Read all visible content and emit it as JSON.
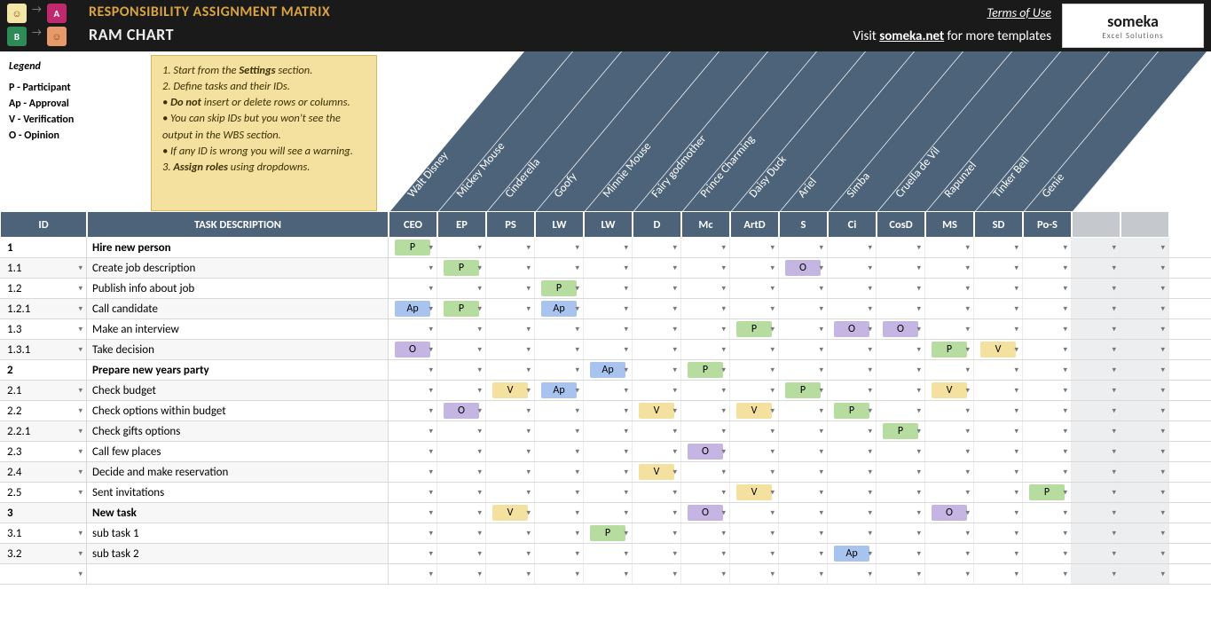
{
  "header": {
    "title1": "RESPONSIBILITY ASSIGNMENT MATRIX",
    "title2": "RAM CHART",
    "terms": "Terms of Use",
    "visit_pre": "Visit ",
    "visit_link": "someka.net",
    "visit_post": " for more templates",
    "logo": "someka",
    "logo_sub": "Excel Solutions",
    "nav_a": "A",
    "nav_b": "B"
  },
  "legend": {
    "title": "Legend",
    "items": [
      "P - Participant",
      "Ap - Approval",
      "V - Verification",
      "O - Opinion"
    ]
  },
  "instructions": [
    "1. Start from the <b>Settings</b> section.",
    "2. Define tasks and their IDs.",
    "• <b>Do not</b> insert or delete rows or columns.",
    "• You can skip IDs but you won't see the output in the WBS section.",
    "• If any ID is wrong you will see a warning.",
    "3. <b>Assign roles</b> using dropdowns."
  ],
  "people": [
    "Walt Disney",
    "Mickey Mouse",
    "Cinderella",
    "Goofy",
    "Minnie Mouse",
    "Fairy godmother",
    "Prince Charming",
    "Daisy Duck",
    "Ariel",
    "Simba",
    "Cruella de Vil",
    "Rapunzel",
    "Tinker Bell",
    "Genie"
  ],
  "col_id": "ID",
  "col_task": "TASK DESCRIPTION",
  "roles": [
    "CEO",
    "EP",
    "PS",
    "LW",
    "LW",
    "D",
    "Mc",
    "ArtD",
    "S",
    "Ci",
    "CosD",
    "MS",
    "SD",
    "Po-S"
  ],
  "extra_cols": 2,
  "rows": [
    {
      "id": "1",
      "task": "Hire new person",
      "bold": true,
      "cells": {
        "0": "P"
      }
    },
    {
      "id": "1.1",
      "task": "Create job description",
      "cells": {
        "1": "P",
        "8": "O"
      }
    },
    {
      "id": "1.2",
      "task": "Publish info about job",
      "cells": {
        "3": "P"
      }
    },
    {
      "id": "1.2.1",
      "task": "Call candidate",
      "cells": {
        "0": "Ap",
        "1": "P",
        "3": "Ap"
      }
    },
    {
      "id": "1.3",
      "task": "Make an interview",
      "cells": {
        "7": "P",
        "9": "O",
        "10": "O"
      }
    },
    {
      "id": "1.3.1",
      "task": "Take decision",
      "cells": {
        "0": "O",
        "11": "P",
        "12": "V"
      }
    },
    {
      "id": "2",
      "task": "Prepare new years party",
      "bold": true,
      "cells": {
        "4": "Ap",
        "6": "P"
      }
    },
    {
      "id": "2.1",
      "task": "Check budget",
      "cells": {
        "2": "V",
        "3": "Ap",
        "8": "P",
        "11": "V"
      }
    },
    {
      "id": "2.2",
      "task": "Check options within budget",
      "cells": {
        "1": "O",
        "5": "V",
        "7": "V",
        "9": "P"
      }
    },
    {
      "id": "2.2.1",
      "task": "Check gifts options",
      "cells": {
        "10": "P"
      }
    },
    {
      "id": "2.3",
      "task": "Call few places",
      "cells": {
        "6": "O"
      }
    },
    {
      "id": "2.4",
      "task": "Decide and make reservation",
      "cells": {
        "5": "V"
      }
    },
    {
      "id": "2.5",
      "task": "Sent invitations",
      "cells": {
        "7": "V",
        "13": "P"
      }
    },
    {
      "id": "3",
      "task": "New task",
      "bold": true,
      "cells": {
        "2": "V",
        "6": "O",
        "11": "O"
      }
    },
    {
      "id": "3.1",
      "task": "sub task 1",
      "cells": {
        "4": "P"
      }
    },
    {
      "id": "3.2",
      "task": "sub task 2",
      "cells": {
        "9": "Ap"
      }
    },
    {
      "id": "",
      "task": "",
      "cells": {}
    }
  ],
  "chart_data": {
    "type": "table",
    "note": "RACI-style matrix cross-tabulating tasks vs. people; see rows + roles above"
  }
}
